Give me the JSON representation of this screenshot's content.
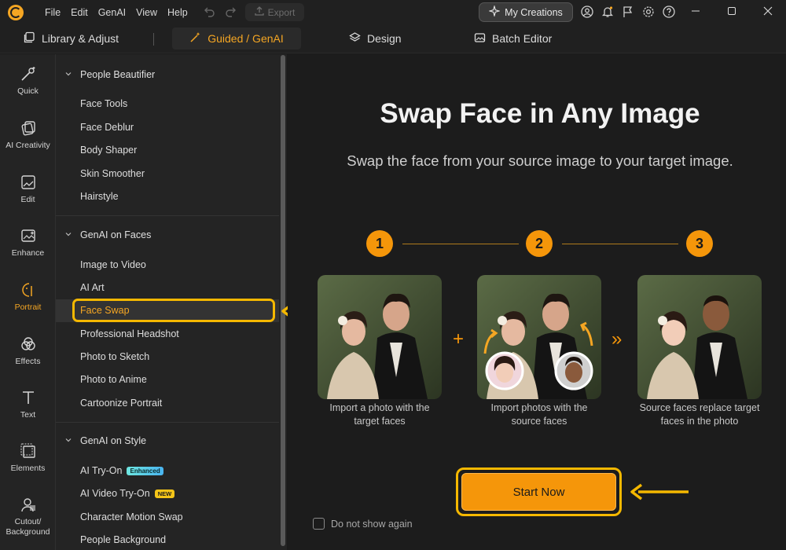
{
  "titlebar": {
    "menus": [
      "File",
      "Edit",
      "GenAI",
      "View",
      "Help"
    ],
    "export_label": "Export",
    "my_creations_label": "My Creations"
  },
  "modes": [
    {
      "label": "Library & Adjust",
      "icon": "library-icon"
    },
    {
      "label": "Guided / GenAI",
      "icon": "magic-wand-icon",
      "active": true
    },
    {
      "label": "Design",
      "icon": "layers-icon"
    },
    {
      "label": "Batch Editor",
      "icon": "batch-images-icon"
    }
  ],
  "rail": [
    {
      "label": "Quick",
      "icon": "magic-wand-icon"
    },
    {
      "label": "AI Creativity",
      "icon": "ai-creativity-icon"
    },
    {
      "label": "Edit",
      "icon": "edit-image-icon"
    },
    {
      "label": "Enhance",
      "icon": "enhance-icon"
    },
    {
      "label": "Portrait",
      "icon": "portrait-icon",
      "active": true
    },
    {
      "label": "Effects",
      "icon": "effects-icon"
    },
    {
      "label": "Text",
      "icon": "text-icon"
    },
    {
      "label": "Elements",
      "icon": "elements-icon"
    },
    {
      "label": "Cutout/\nBackground",
      "icon": "cutout-icon"
    }
  ],
  "panel": {
    "sections": [
      {
        "title": "People Beautifier",
        "items": [
          "Face Tools",
          "Face Deblur",
          "Body Shaper",
          "Skin Smoother",
          "Hairstyle"
        ]
      },
      {
        "title": "GenAI on Faces",
        "items": [
          "Image to Video",
          "AI Art",
          "Face Swap",
          "Professional Headshot",
          "Photo to Sketch",
          "Photo to Anime",
          "Cartoonize Portrait"
        ]
      },
      {
        "title": "GenAI on Style",
        "items": [
          "AI Try-On",
          "AI Video Try-On",
          "Character Motion Swap",
          "People Background"
        ]
      }
    ],
    "badges": {
      "enhanced": "Enhanced",
      "new": "NEW"
    },
    "selected_item": "Face Swap"
  },
  "main": {
    "title": "Swap Face in Any Image",
    "subtitle": "Swap the face from your source image to your target image.",
    "steps": [
      {
        "num": "1",
        "caption_line1": "Import a photo with the",
        "caption_line2": "target faces"
      },
      {
        "num": "2",
        "caption_line1": "Import photos with the",
        "caption_line2": "source faces"
      },
      {
        "num": "3",
        "caption_line1": "Source faces replace target",
        "caption_line2": "faces in the photo"
      }
    ],
    "plus_glyph": "+",
    "next_glyph": "»",
    "start_label": "Start Now",
    "checkbox_label": "Do not show again"
  },
  "colors": {
    "accent": "#f5960a",
    "highlight_box": "#f5b800",
    "bg": "#1c1c1c",
    "panel": "#242424"
  }
}
